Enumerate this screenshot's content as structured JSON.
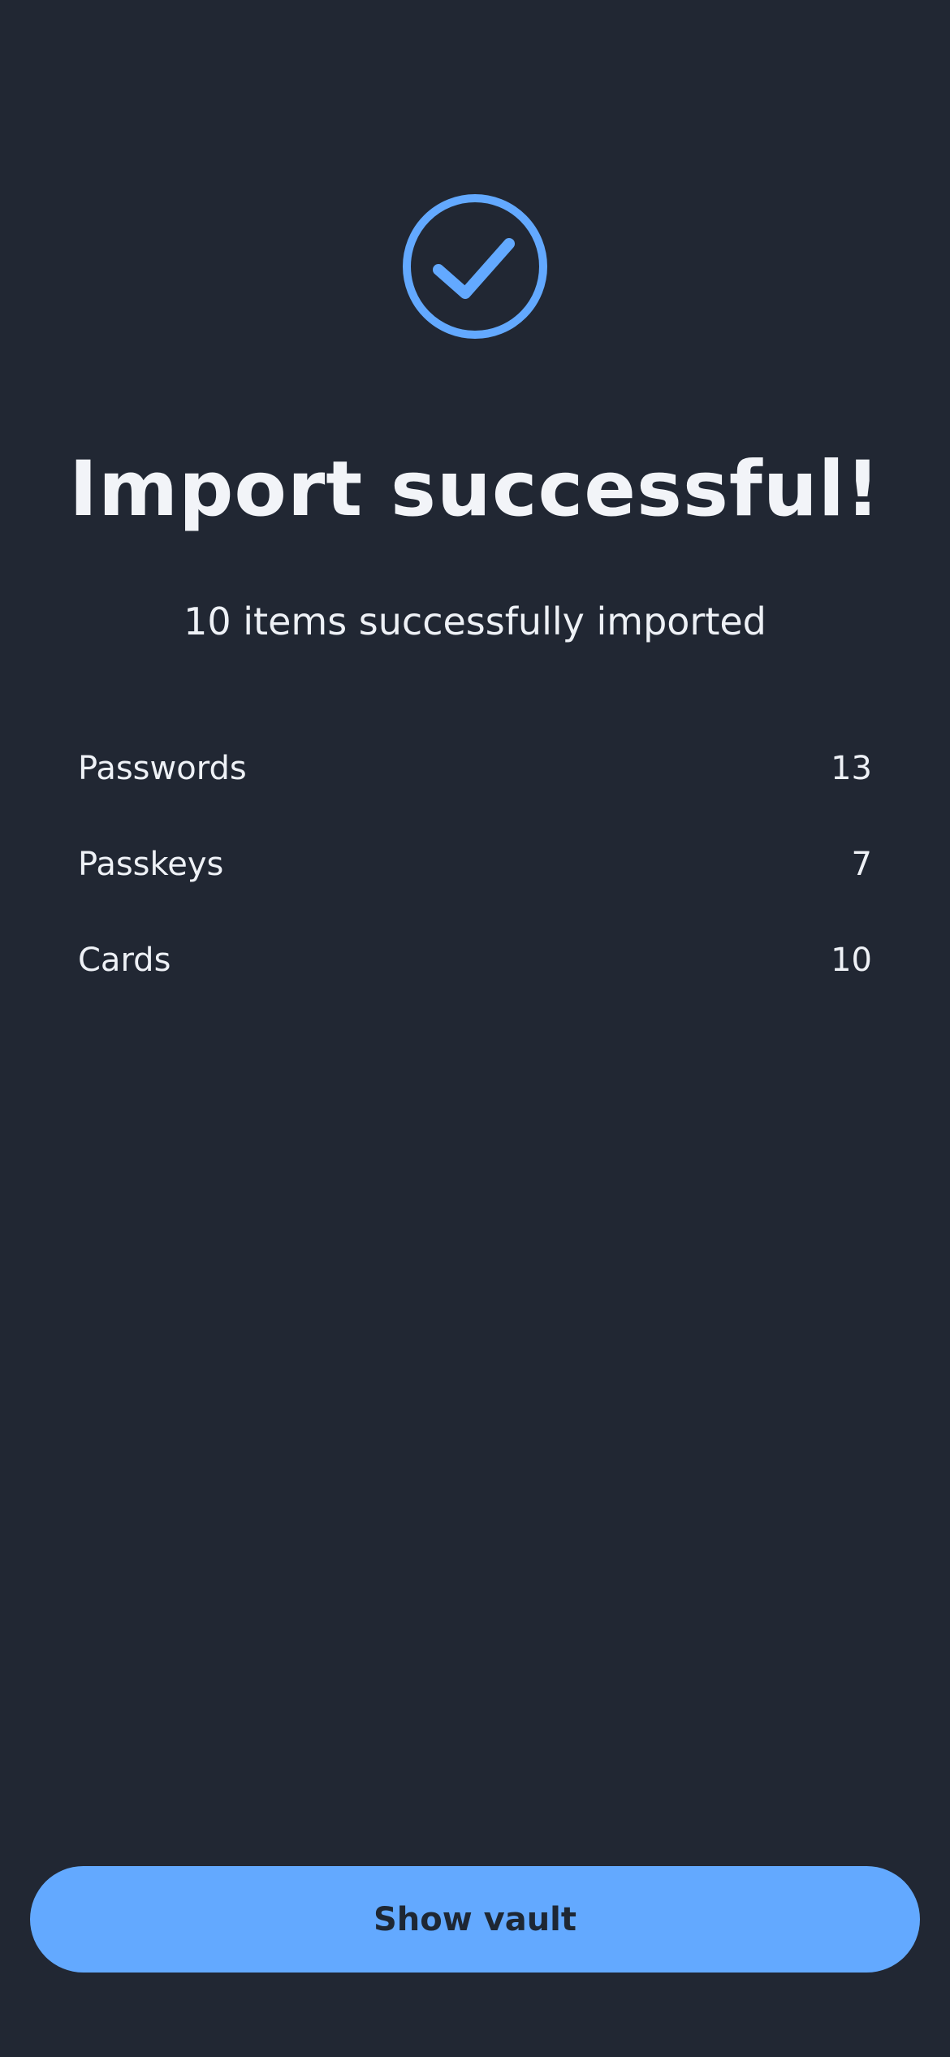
{
  "colors": {
    "background": "#212733",
    "accent": "#63a9ff",
    "text": "#f2f4f8",
    "button_text": "#1e2733"
  },
  "status_icon": "check-circle-icon",
  "title": "Import successful!",
  "subtitle": "10 items successfully imported",
  "summary": {
    "items": [
      {
        "label": "Passwords",
        "count": "13"
      },
      {
        "label": "Passkeys",
        "count": "7"
      },
      {
        "label": "Cards",
        "count": "10"
      }
    ]
  },
  "primary_button": {
    "label": "Show vault"
  }
}
